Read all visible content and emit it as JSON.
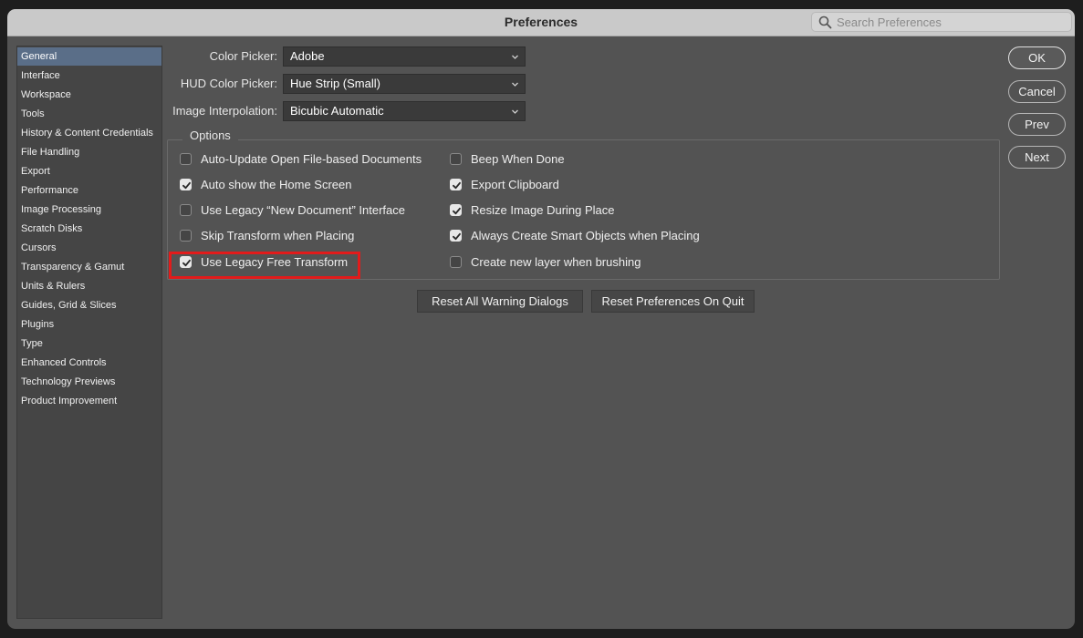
{
  "window": {
    "title": "Preferences",
    "search_placeholder": "Search Preferences"
  },
  "sidebar": {
    "items": [
      {
        "label": "General",
        "selected": true
      },
      {
        "label": "Interface"
      },
      {
        "label": "Workspace"
      },
      {
        "label": "Tools"
      },
      {
        "label": "History & Content Credentials"
      },
      {
        "label": "File Handling"
      },
      {
        "label": "Export"
      },
      {
        "label": "Performance"
      },
      {
        "label": "Image Processing"
      },
      {
        "label": "Scratch Disks"
      },
      {
        "label": "Cursors"
      },
      {
        "label": "Transparency & Gamut"
      },
      {
        "label": "Units & Rulers"
      },
      {
        "label": "Guides, Grid & Slices"
      },
      {
        "label": "Plugins"
      },
      {
        "label": "Type"
      },
      {
        "label": "Enhanced Controls"
      },
      {
        "label": "Technology Previews"
      },
      {
        "label": "Product Improvement"
      }
    ]
  },
  "general": {
    "color_picker": {
      "label": "Color Picker:",
      "value": "Adobe"
    },
    "hud_color_picker": {
      "label": "HUD Color Picker:",
      "value": "Hue Strip (Small)"
    },
    "image_interpolation": {
      "label": "Image Interpolation:",
      "value": "Bicubic Automatic"
    }
  },
  "options": {
    "title": "Options",
    "left": [
      {
        "label": "Auto-Update Open File-based Documents",
        "checked": false
      },
      {
        "label": "Auto show the Home Screen",
        "checked": true
      },
      {
        "label": "Use Legacy “New Document” Interface",
        "checked": false
      },
      {
        "label": "Skip Transform when Placing",
        "checked": false
      },
      {
        "label": "Use Legacy Free Transform",
        "checked": true
      }
    ],
    "right": [
      {
        "label": "Beep When Done",
        "checked": false
      },
      {
        "label": "Export Clipboard",
        "checked": true
      },
      {
        "label": "Resize Image During Place",
        "checked": true
      },
      {
        "label": "Always Create Smart Objects when Placing",
        "checked": true
      },
      {
        "label": "Create new layer when brushing",
        "checked": false
      }
    ]
  },
  "buttons": {
    "reset_warnings": "Reset All Warning Dialogs",
    "reset_prefs": "Reset Preferences On Quit",
    "ok": "OK",
    "cancel": "Cancel",
    "prev": "Prev",
    "next": "Next"
  },
  "colors": {
    "highlight": "#e21b1b",
    "selected_sidebar": "#5a6e88",
    "panel": "#535353"
  }
}
